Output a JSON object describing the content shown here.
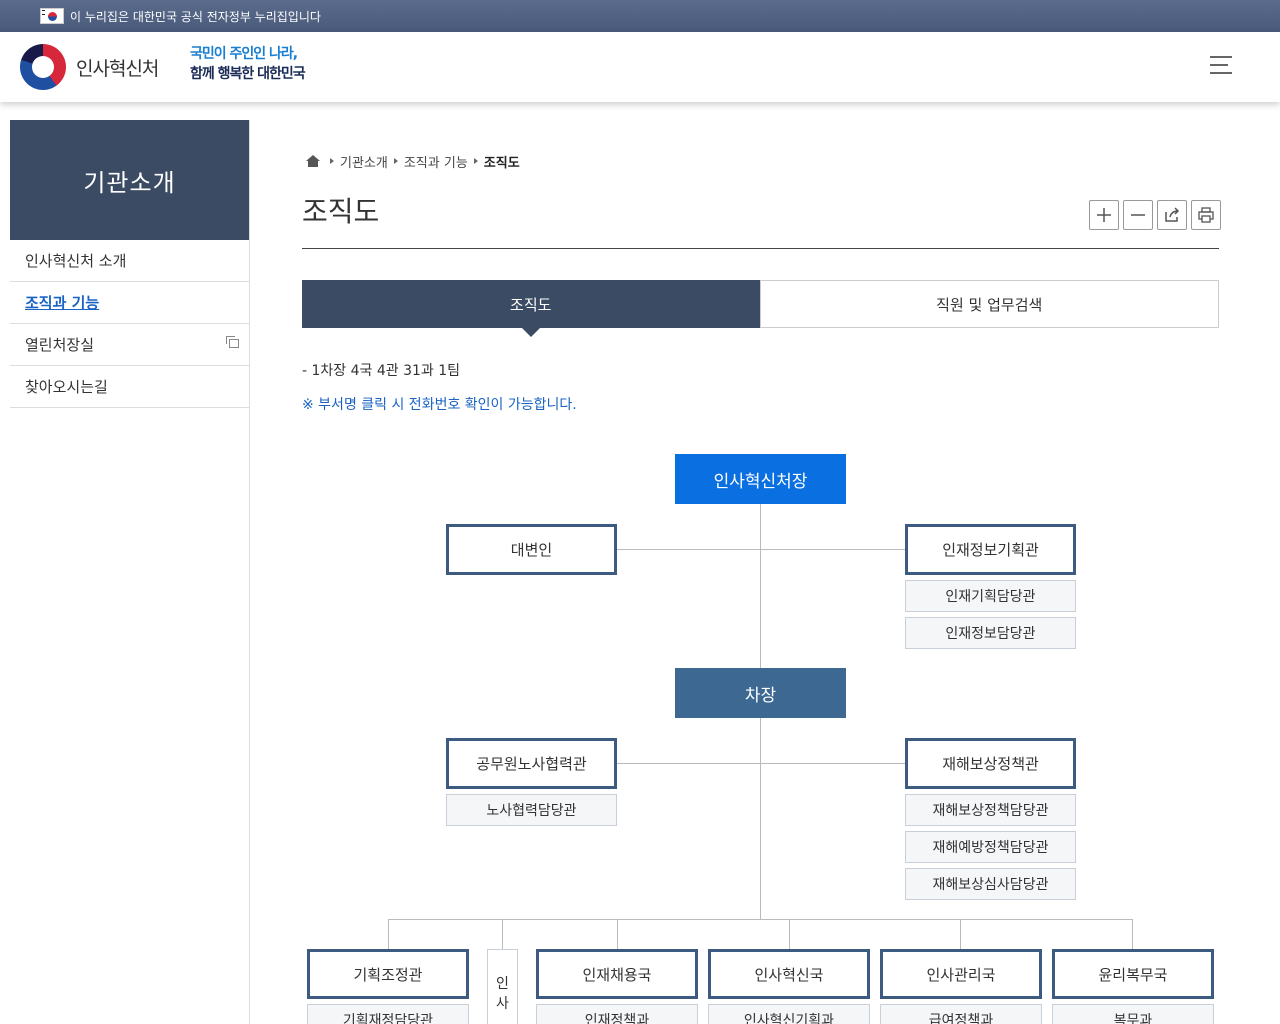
{
  "gov_banner": {
    "text": "이 누리집은 대한민국 공식 전자정부 누리집입니다"
  },
  "header": {
    "logo_text": "인사혁신처",
    "slogan_line1": "국민이 주인인 나라,",
    "slogan_line2": "함께 행복한 대한민국"
  },
  "sidebar": {
    "title": "기관소개",
    "items": [
      {
        "label": "인사혁신처 소개"
      },
      {
        "label": "조직과 기능"
      },
      {
        "label": "열린처장실"
      },
      {
        "label": "찾아오시는길"
      }
    ]
  },
  "breadcrumb": {
    "items": [
      "기관소개",
      "조직과 기능",
      "조직도"
    ]
  },
  "page": {
    "title": "조직도"
  },
  "tools": [
    "plus-icon",
    "minus-icon",
    "share-icon",
    "print-icon"
  ],
  "tabs": [
    {
      "label": "조직도"
    },
    {
      "label": "직원 및 업무검색"
    }
  ],
  "summary": "- 1차장 4국 4관 31과 1팀",
  "notice": "※ 부서명 클릭 시 전화번호 확인이 가능합니다.",
  "org": {
    "head": "인사혁신처장",
    "spokesperson": "대변인",
    "planning_officer": "인재정보기획관",
    "planning_subs": [
      "인재기획담당관",
      "인재정보담당관"
    ],
    "vice": "차장",
    "labor_officer": "공무원노사협력관",
    "labor_subs": [
      "노사협력담당관"
    ],
    "comp_officer": "재해보상정책관",
    "comp_subs": [
      "재해보상정책담당관",
      "재해예방정책담당관",
      "재해보상심사담당관"
    ],
    "bureaus": [
      {
        "name": "기획조정관",
        "first_sub": "기획재정담당관"
      },
      {
        "name": "인재채용국",
        "first_sub": "인재정책과"
      },
      {
        "name": "인사혁신국",
        "first_sub": "인사혁신기획과"
      },
      {
        "name": "인사관리국",
        "first_sub": "급여정책과"
      },
      {
        "name": "윤리복무국",
        "first_sub": "복무과"
      }
    ],
    "vertical_label": [
      "인",
      "사"
    ]
  }
}
